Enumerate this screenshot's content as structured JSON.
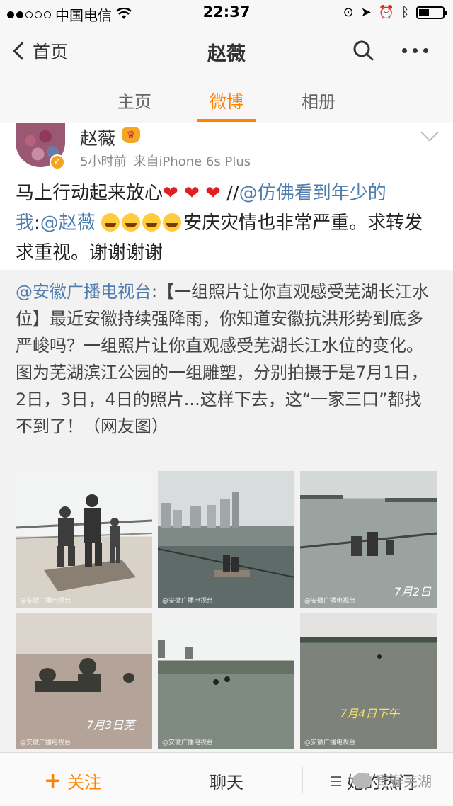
{
  "status_bar": {
    "carrier": "中国电信",
    "time": "22:37"
  },
  "nav": {
    "back_label": "首页",
    "title": "赵薇"
  },
  "tabs": [
    {
      "label": "主页"
    },
    {
      "label": "微博"
    },
    {
      "label": "相册"
    }
  ],
  "post": {
    "author": "赵薇",
    "time": "5小时前",
    "source": "来自iPhone 6s Plus",
    "text_part1": "马上行动起来放心",
    "hearts": "❤ ❤ ❤",
    "sep": " //",
    "mention1": "@仿佛看到年少的我",
    "colon": ":",
    "mention2": "@赵薇",
    "text_part2": "安庆灾情也非常严重。求转发求重视。谢谢谢谢"
  },
  "retweet": {
    "mention": "@安徽广播电视台",
    "text": ":【一组照片让你直观感受芜湖长江水位】最近安徽持续强降雨，你知道安徽抗洪形势到底多严峻吗？一组照片让你直观感受芜湖长江水位的变化。图为芜湖滨江公园的一组雕塑，分别拍摄于是7月1日，2日，3日，4日的照片...这样下去，这“一家三口”都找不到了！（网友图）",
    "photo_captions": [
      "7月2日",
      "7月3日芜",
      "7月4日下午"
    ],
    "watermark": "@安徽广播电视台"
  },
  "bottom_bar": {
    "follow_label": "关注",
    "chat_label": "聊天",
    "hot_label": "她的热门",
    "wechat_watermark": "青春芜湖"
  },
  "colors": {
    "accent": "#ff8200",
    "link": "#507daf"
  }
}
